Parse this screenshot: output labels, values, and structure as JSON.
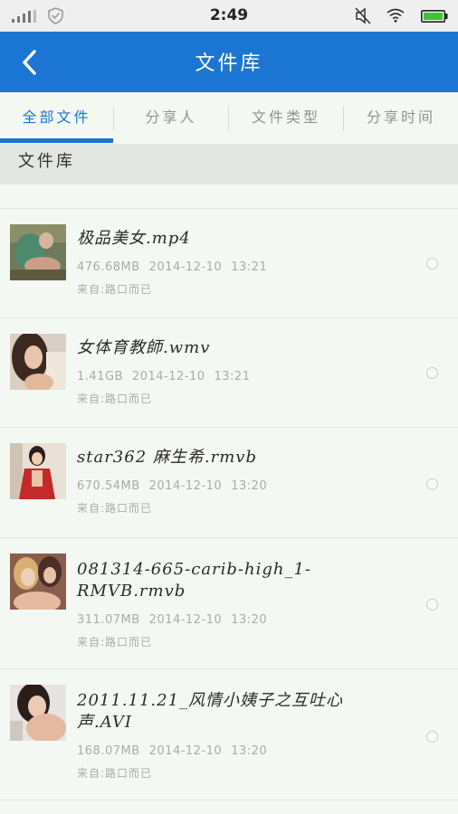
{
  "status_bar": {
    "time": "2:49",
    "icons": [
      "signal-icon",
      "shield-icon",
      "mute-icon",
      "wifi-icon",
      "battery-icon"
    ]
  },
  "header": {
    "title": "文件库",
    "back_icon": "chevron-left-icon"
  },
  "tabs": [
    {
      "label": "全部文件",
      "active": true
    },
    {
      "label": "分享人",
      "active": false
    },
    {
      "label": "文件类型",
      "active": false
    },
    {
      "label": "分享时间",
      "active": false
    }
  ],
  "section_title": "文件库",
  "files": [
    {
      "name": "极品美女.mp4",
      "size": "476.68MB",
      "date": "2014-12-10",
      "time": "13:21",
      "source": "来自:路口而已"
    },
    {
      "name": "女体育教師.wmv",
      "size": "1.41GB",
      "date": "2014-12-10",
      "time": "13:21",
      "source": "来自:路口而已"
    },
    {
      "name": "star362 麻生希.rmvb",
      "size": "670.54MB",
      "date": "2014-12-10",
      "time": "13:20",
      "source": "来自:路口而已"
    },
    {
      "name": "081314-665-carib-high_1-RMVB.rmvb",
      "size": "311.07MB",
      "date": "2014-12-10",
      "time": "13:20",
      "source": "来自:路口而已"
    },
    {
      "name": "2011.11.21_风情小姨子之互吐心声.AVI",
      "size": "168.07MB",
      "date": "2014-12-10",
      "time": "13:20",
      "source": "来自:路口而已"
    }
  ],
  "colors": {
    "accent": "#1b76d3",
    "background": "#f4f8f3",
    "section_bg": "#e4e6e4",
    "muted_text": "#a8ada8"
  }
}
